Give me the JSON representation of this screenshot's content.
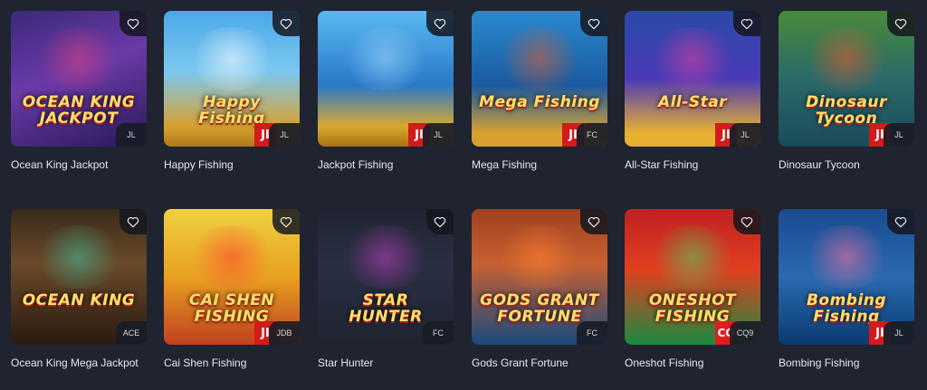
{
  "games": [
    {
      "name": "Ocean King Jackpot",
      "art_title": "OCEAN KING JACKPOT",
      "provider": "JL",
      "brand": "",
      "bg": "linear-gradient(160deg,#3a2a7a 0%,#6a3aa8 45%,#2a1a5a 100%)",
      "glow": "#e04080"
    },
    {
      "name": "Happy Fishing",
      "art_title": "Happy Fishing",
      "provider": "JL",
      "brand": "JI",
      "bg": "linear-gradient(180deg,#4aa8e8 0%,#7cc8f0 45%,#d8a030 85%,#b07818 100%)",
      "glow": "#ffffff"
    },
    {
      "name": "Jackpot Fishing",
      "art_title": "",
      "provider": "JL",
      "brand": "JI",
      "bg": "linear-gradient(180deg,#58b8f0 0%,#2a78c8 55%,#d8a830 85%,#a87010 100%)",
      "glow": "#9fd8ff"
    },
    {
      "name": "Mega Fishing",
      "art_title": "Mega Fishing",
      "provider": "FC",
      "brand": "JI",
      "bg": "linear-gradient(180deg,#2a8ad0 0%,#1a5aa0 55%,#d8a030 90%)",
      "glow": "#e06030"
    },
    {
      "name": "All-Star Fishing",
      "art_title": "All-Star",
      "provider": "JL",
      "brand": "JI",
      "bg": "linear-gradient(180deg,#2a4aa8 0%,#4a3ab8 50%,#e8b030 90%)",
      "glow": "#e040a0"
    },
    {
      "name": "Dinosaur Tycoon",
      "art_title": "Dinosaur Tycoon",
      "provider": "JL",
      "brand": "JI",
      "bg": "linear-gradient(180deg,#4a8a3a 0%,#2a6a6a 50%,#1a4a5a 100%)",
      "glow": "#e85a30"
    },
    {
      "name": "Ocean King Mega Jackpot",
      "art_title": "OCEAN KING",
      "provider": "ACE",
      "brand": "",
      "bg": "linear-gradient(180deg,#3a2a1a 0%,#6a4a2a 40%,#2a1a10 100%)",
      "glow": "#40c0a0"
    },
    {
      "name": "Cai Shen Fishing",
      "art_title": "CAI SHEN FISHING",
      "provider": "JDB",
      "brand": "JI",
      "bg": "linear-gradient(180deg,#f0d040 0%,#e8a020 50%,#c04020 100%)",
      "glow": "#ff4030"
    },
    {
      "name": "Star Hunter",
      "art_title": "STAR HUNTER",
      "provider": "FC",
      "brand": "",
      "bg": "linear-gradient(180deg,#1f2430 0%,#2a2f45 40%,#1f2430 100%)",
      "glow": "#c040c0"
    },
    {
      "name": "Gods Grant Fortune",
      "art_title": "GODS GRANT FORTUNE",
      "provider": "FC",
      "brand": "",
      "bg": "linear-gradient(180deg,#a04020 0%,#c86030 40%,#1a4a80 100%)",
      "glow": "#ff8030"
    },
    {
      "name": "Oneshot Fishing",
      "art_title": "ONESHOT FISHING",
      "provider": "CQ9",
      "brand": "CQ",
      "bg": "linear-gradient(180deg,#c02020 0%,#e04020 45%,#1a8a40 100%)",
      "glow": "#50d060"
    },
    {
      "name": "Bombing Fishing",
      "art_title": "Bombing Fishing",
      "provider": "JL",
      "brand": "JI",
      "bg": "linear-gradient(180deg,#1a4a90 0%,#2a6ab0 50%,#0a3a70 100%)",
      "glow": "#ff70a0"
    }
  ],
  "colors": {
    "background": "#1f2430",
    "favorite_icon": "#f2f2f2",
    "brand_red": "#d41a1a"
  },
  "icons": {
    "favorite": "heart-outline-icon"
  }
}
